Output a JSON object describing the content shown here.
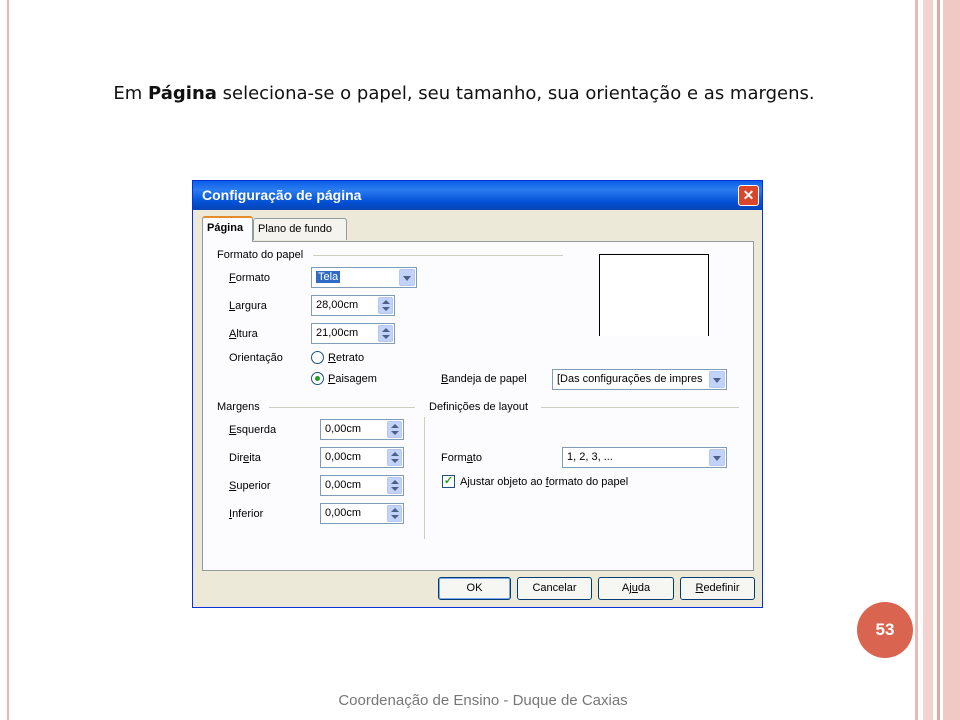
{
  "slide": {
    "caption_pre": "Em ",
    "caption_bold": "Página",
    "caption_post": " seleciona-se o papel, seu tamanho, sua orientação e as margens.",
    "page_number": "53",
    "footer": "Coordenação de Ensino - Duque de Caxias"
  },
  "dialog": {
    "title": "Configuração de página",
    "close_icon": "close-icon",
    "tabs": [
      {
        "label": "Página",
        "active": true
      },
      {
        "label": "Plano de fundo",
        "active": false
      }
    ],
    "paper_format": {
      "group_label": "Formato do papel",
      "format_label_u": "F",
      "format_label_rest": "ormato",
      "format_value": "Tela",
      "width_label_u": "L",
      "width_label_rest": "argura",
      "width_value": "28,00cm",
      "height_label_u": "A",
      "height_label_rest": "ltura",
      "height_value": "21,00cm",
      "orientation_label": "Orientação",
      "portrait_u": "R",
      "portrait_rest": "etrato",
      "landscape_u": "P",
      "landscape_rest": "aisagem",
      "selected_orientation": "Paisagem"
    },
    "paper_tray": {
      "label_u": "B",
      "label_rest": "andeja de papel",
      "value": "[Das configurações de impres"
    },
    "margins": {
      "group_label": "Margens",
      "left_u": "E",
      "left_rest": "squerda",
      "left_value": "0,00cm",
      "right_pre": "Dir",
      "right_u": "e",
      "right_rest": "ita",
      "right_value": "0,00cm",
      "top_u": "S",
      "top_rest": "uperior",
      "top_value": "0,00cm",
      "bottom_u": "I",
      "bottom_rest": "nferior",
      "bottom_value": "0,00cm"
    },
    "layout": {
      "group_label": "Definições de layout",
      "format_pre": "Form",
      "format_u": "a",
      "format_rest": "to",
      "format_value": "1, 2, 3, ...",
      "fit_pre": "Ajustar objeto ao ",
      "fit_u": "f",
      "fit_rest": "ormato do papel",
      "fit_checked": true
    },
    "buttons": {
      "ok": "OK",
      "cancel": "Cancelar",
      "help_pre": "Aj",
      "help_u": "u",
      "help_rest": "da",
      "reset_u": "R",
      "reset_rest": "edefinir"
    }
  },
  "colors": {
    "title_bar": "#0553d8",
    "badge": "#d9644f",
    "accent_stripe": "#f0c8c4"
  }
}
